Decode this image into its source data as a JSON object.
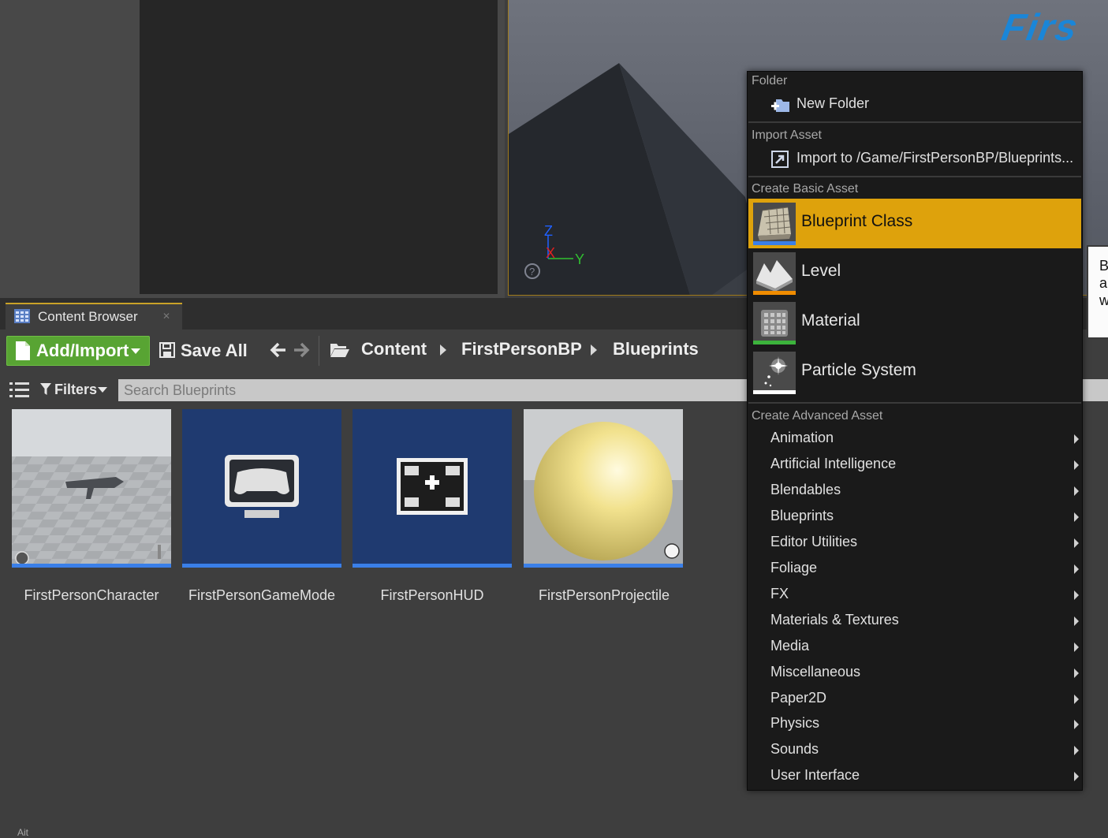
{
  "viewport": {
    "logo_text": "Firs",
    "axis": {
      "z": "Z",
      "x": "X",
      "y": "Y"
    },
    "colors": {
      "x": "#e02020",
      "y": "#30c030",
      "z": "#2060ff"
    }
  },
  "content_browser": {
    "tab_label": "Content Browser",
    "tab_close": "✕",
    "toolbar": {
      "add_import_label": "Add/Import",
      "save_all_label": "Save All",
      "back_arrow": "🡐",
      "forward_arrow": "🡒",
      "breadcrumbs": [
        "Content",
        "FirstPersonBP",
        "Blueprints"
      ]
    },
    "filters_label": "Filters",
    "search_placeholder": "Search Blueprints",
    "assets": [
      {
        "name": "FirstPersonCharacter",
        "icon": "character-thumbnail-icon"
      },
      {
        "name": "FirstPersonGameMode",
        "icon": "gamepad-monitor-icon"
      },
      {
        "name": "FirstPersonHUD",
        "icon": "hud-layout-icon"
      },
      {
        "name": "FirstPersonProjectile",
        "icon": "sphere-thumbnail-icon"
      }
    ]
  },
  "context_menu": {
    "folder_header": "Folder",
    "new_folder_label": "New Folder",
    "import_header": "Import Asset",
    "import_label": "Import to /Game/FirstPersonBP/Blueprints...",
    "basic_header": "Create Basic Asset",
    "basic_items": [
      {
        "label": "Blueprint Class",
        "accent": "#3a7fe8",
        "icon": "blueprint-class-icon"
      },
      {
        "label": "Level",
        "accent": "#f08c00",
        "icon": "level-icon"
      },
      {
        "label": "Material",
        "accent": "#3cb33c",
        "icon": "material-icon"
      },
      {
        "label": "Particle System",
        "accent": "#ffffff",
        "icon": "particle-system-icon"
      }
    ],
    "advanced_header": "Create Advanced Asset",
    "advanced_items": [
      "Animation",
      "Artificial Intelligence",
      "Blendables",
      "Blueprints",
      "Editor Utilities",
      "Foliage",
      "FX",
      "Materials & Textures",
      "Media",
      "Miscellaneous",
      "Paper2D",
      "Physics",
      "Sounds",
      "User Interface"
    ],
    "highlight_color": "#dea20c"
  },
  "tooltip": {
    "lines": [
      "B",
      "a",
      "w"
    ]
  },
  "bottom_stub": "Ait"
}
